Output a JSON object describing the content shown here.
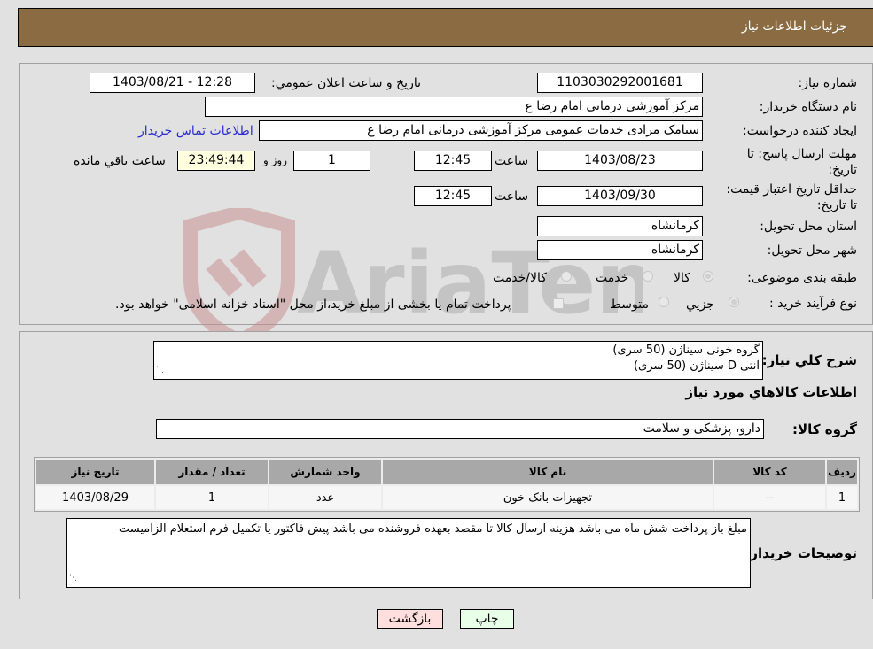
{
  "header": {
    "title": "جزئیات اطلاعات نیاز"
  },
  "form": {
    "need_number": {
      "label": "شماره نیاز:",
      "value": "1103030292001681"
    },
    "announce_datetime": {
      "label": "تاریخ و ساعت اعلان عمومي:",
      "value": "1403/08/21 - 12:28"
    },
    "buyer_org": {
      "label": "نام دستگاه خریدار:",
      "value": "مرکز آموزشی  درمانی امام رضا  ع"
    },
    "requester": {
      "label": "ایجاد کننده درخواست:",
      "value": "سیامک مرادی خدمات عمومی مرکز آموزشی  درمانی امام رضا  ع"
    },
    "buyer_contact_link": "اطلاعات تماس خریدار",
    "reply_deadline": {
      "label": "مهلت ارسال پاسخ: تا تاریخ:",
      "date": "1403/08/23",
      "time_label": "ساعت",
      "time": "12:45",
      "days": "1",
      "days_label": "روز و",
      "remaining": "23:49:44",
      "remaining_label": "ساعت باقي مانده"
    },
    "price_validity": {
      "label": "حداقل تاریخ اعتبار قیمت: تا تاریخ:",
      "date": "1403/09/30",
      "time_label": "ساعت",
      "time": "12:45"
    },
    "delivery_province": {
      "label": "استان محل تحویل:",
      "value": "کرمانشاه"
    },
    "delivery_city": {
      "label": "شهر محل تحویل:",
      "value": "کرمانشاه"
    },
    "category": {
      "label": "طبقه بندی موضوعی:",
      "options": [
        "کالا",
        "خدمت",
        "کالا/خدمت"
      ],
      "selected": "کالا"
    },
    "purchase_type": {
      "label": "نوع فرآیند خرید :",
      "options": [
        "جزيي",
        "متوسط"
      ],
      "selected": "جزيي",
      "treasury_note": "پرداخت تمام یا بخشی از مبلغ خرید،از محل \"اسناد خزانه اسلامی\" خواهد بود."
    }
  },
  "details": {
    "description_label": "شرح كلي نياز:",
    "description_lines": [
      "گروه خونی سیناژن (50 سری)",
      "آنتی D سیناژن (50 سری)"
    ],
    "goods_info_title": "اطلاعات كالاهاي مورد نياز",
    "goods_group_label": "گروه كالا:",
    "goods_group_value": "دارو، پزشکی و سلامت",
    "table": {
      "headers": [
        "ردیف",
        "کد کالا",
        "نام کالا",
        "واحد شمارش",
        "تعداد / مقدار",
        "تاریخ نیاز"
      ],
      "rows": [
        [
          "1",
          "--",
          "تجهیزات بانک خون",
          "عدد",
          "1",
          "1403/08/29"
        ]
      ]
    },
    "buyer_notes_label": "توضیحات خریدار:",
    "buyer_notes": "مبلغ باز پرداخت شش ماه می باشد هزینه ارسال کالا تا مقصد بعهده فروشنده می باشد پیش فاکتور یا تکمیل فرم استعلام الزامیست"
  },
  "buttons": {
    "print": "چاپ",
    "back": "بازگشت"
  },
  "watermark": {
    "text": "AriaTender.neT"
  },
  "colors": {
    "header_bg": "#8b6b42",
    "print_bg": "#e8ffe8",
    "back_bg": "#ffdede",
    "link": "#2b2bd0"
  }
}
